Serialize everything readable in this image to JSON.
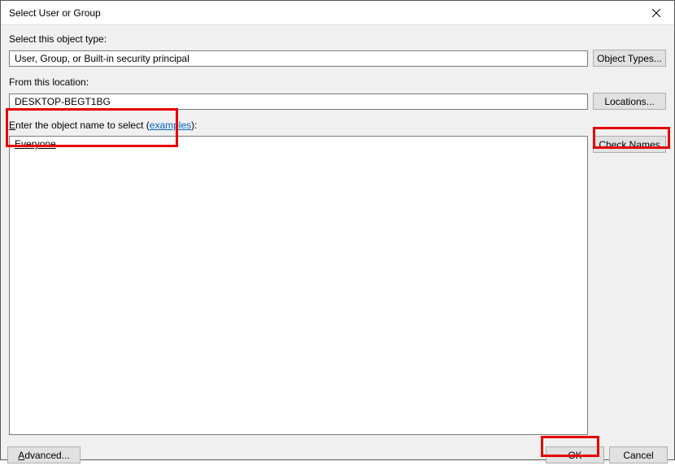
{
  "window": {
    "title": "Select User or Group"
  },
  "objectType": {
    "label": "Select this object type:",
    "value": "User, Group, or Built-in security principal",
    "button": "Object Types..."
  },
  "location": {
    "label": "From this location:",
    "value": "DESKTOP-BEGT1BG",
    "button": "Locations..."
  },
  "entry": {
    "label_pre": "E",
    "label_post": "nter the object name to select (",
    "examples": "examples",
    "label_end": "):",
    "value": "Everyone",
    "checkNames": "Check Names"
  },
  "footer": {
    "advanced": "Advanced...",
    "ok": "OK",
    "cancel": "Cancel"
  }
}
